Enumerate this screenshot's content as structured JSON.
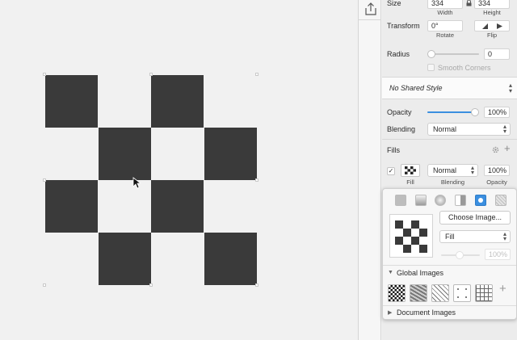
{
  "size": {
    "label": "Size",
    "width": "334",
    "height": "334",
    "width_label": "Width",
    "height_label": "Height"
  },
  "transform": {
    "label": "Transform",
    "rotate": "0°",
    "rotate_label": "Rotate",
    "flip_label": "Flip"
  },
  "radius": {
    "label": "Radius",
    "value": "0",
    "smooth_corners": "Smooth Corners"
  },
  "shared_style": {
    "value": "No Shared Style"
  },
  "opacity": {
    "label": "Opacity",
    "value": "100%",
    "fraction": 1.0
  },
  "blending": {
    "label": "Blending",
    "value": "Normal"
  },
  "fills": {
    "title": "Fills",
    "blend": "Normal",
    "opacity": "100%",
    "fill_label": "Fill",
    "blending_label": "Blending",
    "opacity_label": "Opacity"
  },
  "fill_popover": {
    "choose_image": "Choose Image...",
    "mode": "Fill",
    "opacity": "100%",
    "global_images": "Global Images",
    "document_images": "Document Images",
    "fill_types": [
      "solid-fill-icon",
      "linear-gradient-icon",
      "radial-gradient-icon",
      "angular-gradient-icon",
      "pattern-fill-icon",
      "noise-fill-icon"
    ]
  },
  "colors": {
    "accent": "#3b8fe0",
    "tile": "#3a3a3a"
  }
}
